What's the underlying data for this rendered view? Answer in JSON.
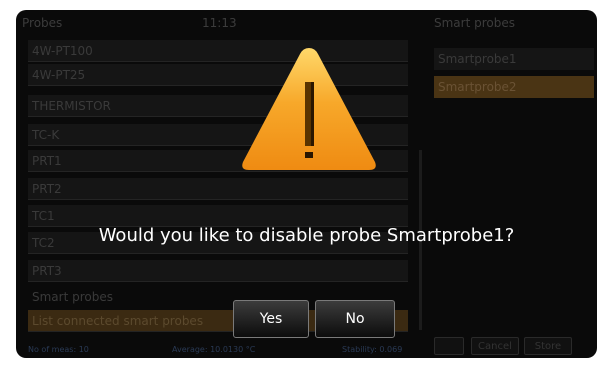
{
  "header": {
    "probes_title": "Probes",
    "time": "11:13",
    "smart_probes_title": "Smart probes"
  },
  "probe_list": [
    "4W-PT100",
    "4W-PT25",
    "THERMISTOR",
    "TC-K",
    "PRT1",
    "PRT2",
    "TC1",
    "TC2",
    "PRT3"
  ],
  "smart_probes_section": {
    "label": "Smart probes",
    "list_connected_button": "List connected smart probes"
  },
  "smart_probe_list": [
    "Smartprobe1",
    "Smartprobe2"
  ],
  "status_bar": {
    "meas_count": "No of meas: 10",
    "average": "Average: 10.0130 °C",
    "stability": "Stability: 0.069"
  },
  "right_buttons": {
    "cancel": "Cancel",
    "store": "Store"
  },
  "dialog": {
    "message": "Would you like to disable probe Smartprobe1?",
    "yes": "Yes",
    "no": "No",
    "warning_color": "#f5a623"
  }
}
